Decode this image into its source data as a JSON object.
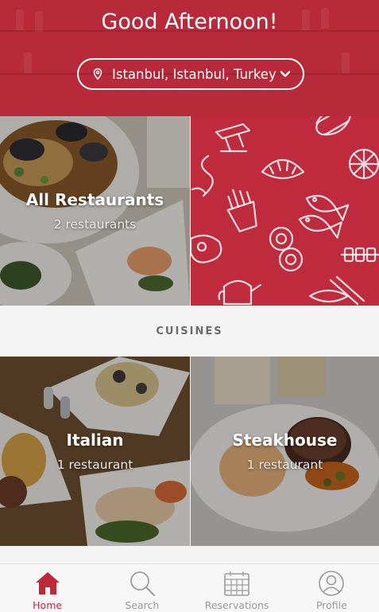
{
  "header": {
    "greeting": "Good Afternoon!",
    "location": "Istanbul, Istanbul, Turkey",
    "location_icon": "map-pin-icon",
    "dropdown_icon": "chevron-down-icon",
    "background_color": "#b8293a"
  },
  "featured": {
    "title": "All Restaurants",
    "count": "2 restaurants"
  },
  "section": {
    "label": "CUISINES"
  },
  "cuisines": [
    {
      "name": "Italian",
      "count": "1 restaurant"
    },
    {
      "name": "Steakhouse",
      "count": "1 restaurant"
    }
  ],
  "tabs": [
    {
      "label": "Home",
      "icon": "home-icon",
      "active": true
    },
    {
      "label": "Search",
      "icon": "search-icon",
      "active": false
    },
    {
      "label": "Reservations",
      "icon": "calendar-icon",
      "active": false
    },
    {
      "label": "Profile",
      "icon": "profile-icon",
      "active": false
    }
  ],
  "colors": {
    "accent": "#c0283a",
    "pattern_bg": "#bf2b3c",
    "tab_inactive": "#9b9b9b"
  }
}
